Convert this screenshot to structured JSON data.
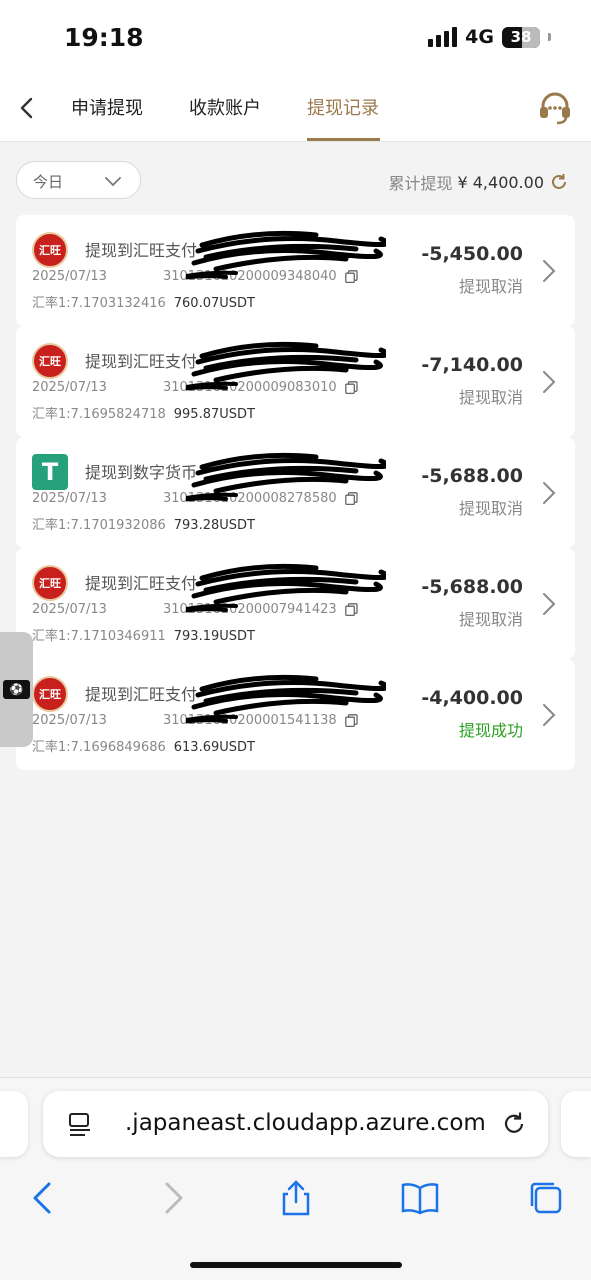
{
  "status_bar": {
    "time": "19:18",
    "network": "4G",
    "battery": "38"
  },
  "nav": {
    "tabs": [
      "申请提现",
      "收款账户",
      "提现记录"
    ],
    "active_tab": "提现记录"
  },
  "filter": {
    "selected": "今日"
  },
  "summary": {
    "label": "累计提现",
    "amount": "¥ 4,400.00"
  },
  "records": [
    {
      "icon": "huiwang-logo",
      "logo_text": "汇旺",
      "title": "提现到汇旺支付",
      "time": "2025/07/13",
      "order_no": "310131620200009348040",
      "rate_label": "汇率1:7.1703132416",
      "usdt": "760.07USDT",
      "amount": "-5,450.00",
      "status": "提现取消"
    },
    {
      "icon": "huiwang-logo",
      "logo_text": "汇旺",
      "title": "提现到汇旺支付",
      "time": "2025/07/13",
      "order_no": "310131620200009083010",
      "rate_label": "汇率1:7.1695824718",
      "usdt": "995.87USDT",
      "amount": "-7,140.00",
      "status": "提现取消"
    },
    {
      "icon": "usdt-tether-logo",
      "logo_text": "T",
      "title": "提现到数字货币",
      "time": "2025/07/13",
      "order_no": "310131620200008278580",
      "rate_label": "汇率1:7.1701932086",
      "usdt": "793.28USDT",
      "amount": "-5,688.00",
      "status": "提现取消"
    },
    {
      "icon": "huiwang-logo",
      "logo_text": "汇旺",
      "title": "提现到汇旺支付",
      "time": "2025/07/13",
      "order_no": "310131620200007941423",
      "rate_label": "汇率1:7.1710346911",
      "usdt": "793.19USDT",
      "amount": "-5,688.00",
      "status": "提现取消"
    },
    {
      "icon": "huiwang-logo",
      "logo_text": "汇旺",
      "title": "提现到汇旺支付",
      "time": "2025/07/13",
      "order_no": "310131620200001541138",
      "rate_label": "汇率1:7.1696849686",
      "usdt": "613.69USDT",
      "amount": "-4,400.00",
      "status": "提现成功"
    }
  ],
  "browser": {
    "url": ".japaneast.cloudapp.azure.com"
  },
  "colors": {
    "accent": "#9a7a4c",
    "success": "#2ea023",
    "huiwang_red": "#c8201c",
    "usdt_green": "#26a17b"
  }
}
